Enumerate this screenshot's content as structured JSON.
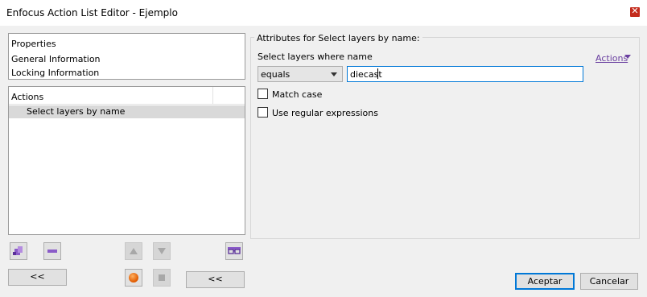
{
  "window": {
    "title": "Enfocus Action List Editor - Ejemplo"
  },
  "properties": {
    "header": "Properties",
    "items": [
      "General Information",
      "Locking Information"
    ]
  },
  "actions_list": {
    "header": "Actions",
    "items": [
      "Select layers by name"
    ]
  },
  "toolbar": {
    "collapse_left_label": "<<",
    "collapse_right_label": "<<",
    "icons": [
      "add-action-icon",
      "remove-action-icon",
      "move-up-icon",
      "move-down-icon",
      "preview-glasses-icon",
      "record-icon",
      "stop-icon"
    ]
  },
  "attributes": {
    "group_label": "Attributes for Select layers by name:",
    "select_label": "Select layers where name",
    "actions_link": "Actions",
    "operator_value": "equals",
    "name_value": "diecast",
    "match_case_label": "Match case",
    "regex_label": "Use regular expressions"
  },
  "footer": {
    "ok_label": "Aceptar",
    "cancel_label": "Cancelar"
  },
  "colors": {
    "accent": "#0078d7",
    "link": "#6a3fa0",
    "close": "#c42b1c",
    "selected_row": "#d9d9d9"
  }
}
